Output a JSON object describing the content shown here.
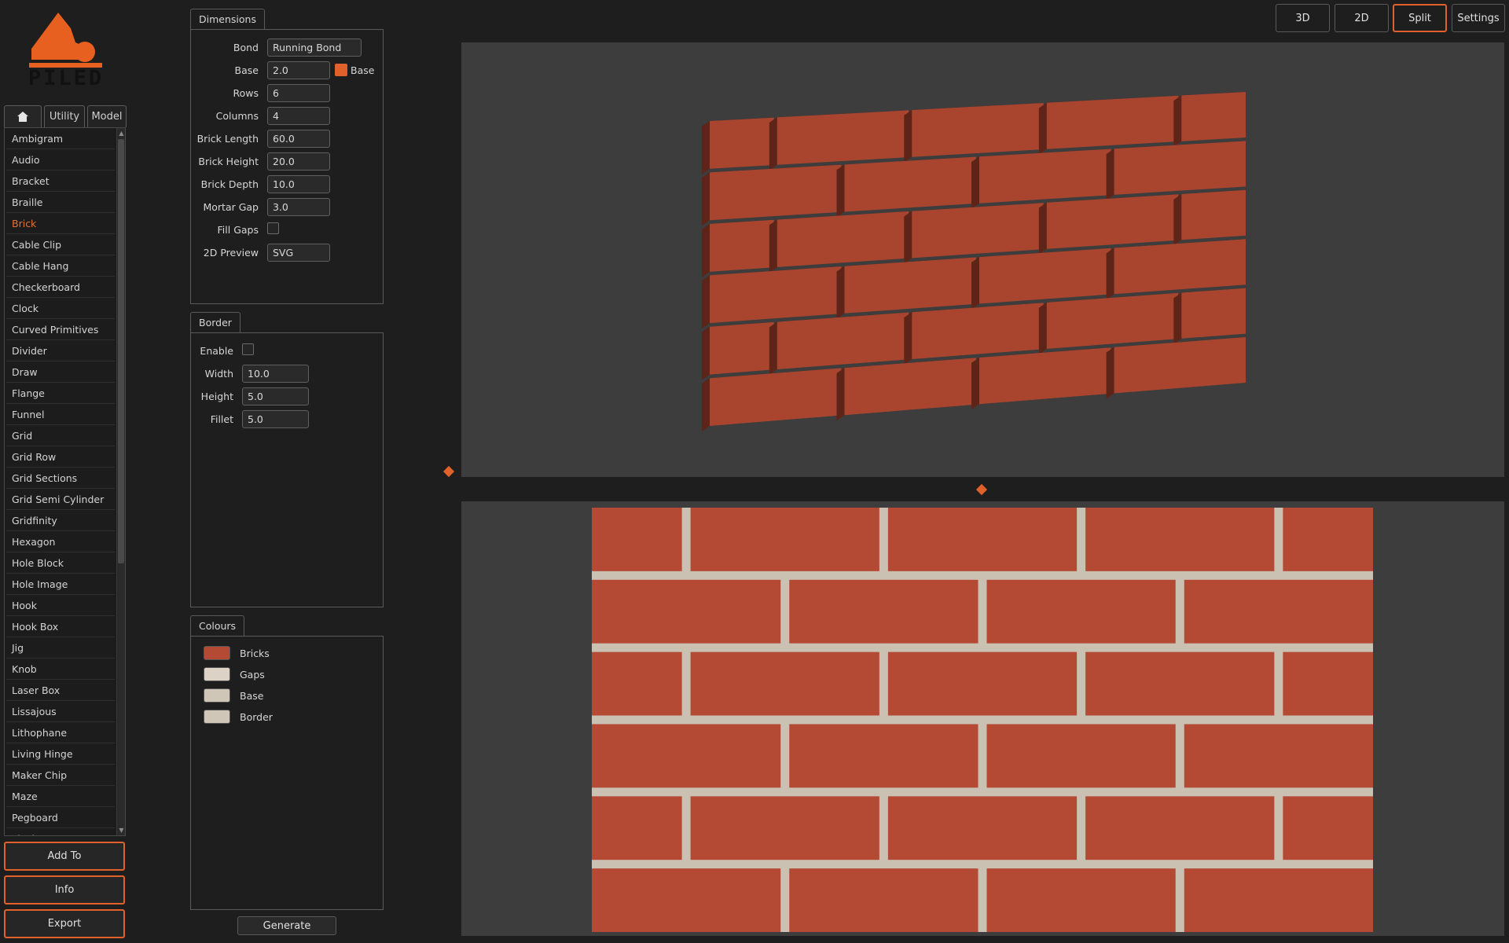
{
  "app": {
    "logo_text": "PILED"
  },
  "left_tabs": {
    "home_icon": "home-icon",
    "utility": "Utility",
    "model": "Model"
  },
  "categories": [
    "Ambigram",
    "Audio",
    "Bracket",
    "Braille",
    "Brick",
    "Cable Clip",
    "Cable Hang",
    "Checkerboard",
    "Clock",
    "Curved Primitives",
    "Divider",
    "Draw",
    "Flange",
    "Funnel",
    "Grid",
    "Grid Row",
    "Grid Sections",
    "Grid Semi Cylinder",
    "Gridfinity",
    "Hexagon",
    "Hole Block",
    "Hole Image",
    "Hook",
    "Hook Box",
    "Jig",
    "Knob",
    "Laser Box",
    "Lissajous",
    "Lithophane",
    "Living Hinge",
    "Maker Chip",
    "Maze",
    "Pegboard",
    "Pixel Art"
  ],
  "selected_category": "Brick",
  "side_buttons": {
    "add_to": "Add To",
    "info": "Info",
    "export": "Export"
  },
  "dimensions": {
    "title": "Dimensions",
    "bond_label": "Bond",
    "bond_value": "Running Bond",
    "base_label": "Base",
    "base_value": "2.0",
    "base_toggle_label": "Base",
    "rows_label": "Rows",
    "rows_value": "6",
    "columns_label": "Columns",
    "columns_value": "4",
    "brick_length_label": "Brick Length",
    "brick_length_value": "60.0",
    "brick_height_label": "Brick Height",
    "brick_height_value": "20.0",
    "brick_depth_label": "Brick Depth",
    "brick_depth_value": "10.0",
    "mortar_gap_label": "Mortar Gap",
    "mortar_gap_value": "3.0",
    "fill_gaps_label": "Fill Gaps",
    "preview_label": "2D Preview",
    "preview_value": "SVG"
  },
  "border": {
    "title": "Border",
    "enable_label": "Enable",
    "width_label": "Width",
    "width_value": "10.0",
    "height_label": "Height",
    "height_value": "5.0",
    "fillet_label": "Fillet",
    "fillet_value": "5.0"
  },
  "colours": {
    "title": "Colours",
    "items": [
      {
        "label": "Bricks",
        "color": "#b44a34"
      },
      {
        "label": "Gaps",
        "color": "#dcd3c6"
      },
      {
        "label": "Base",
        "color": "#cfc6b8"
      },
      {
        "label": "Border",
        "color": "#cfc6b8"
      }
    ]
  },
  "generate_label": "Generate",
  "view_buttons": {
    "b3d": "3D",
    "b2d": "2D",
    "split": "Split",
    "settings": "Settings",
    "active": "Split"
  },
  "theme": {
    "accent": "#e0612a",
    "brick": "#b44a34",
    "mortar": "#cbc1b3",
    "viewport_bg": "#3d3d3d"
  },
  "wall": {
    "rows": 6,
    "columns": 4,
    "bond": "Running Bond"
  }
}
